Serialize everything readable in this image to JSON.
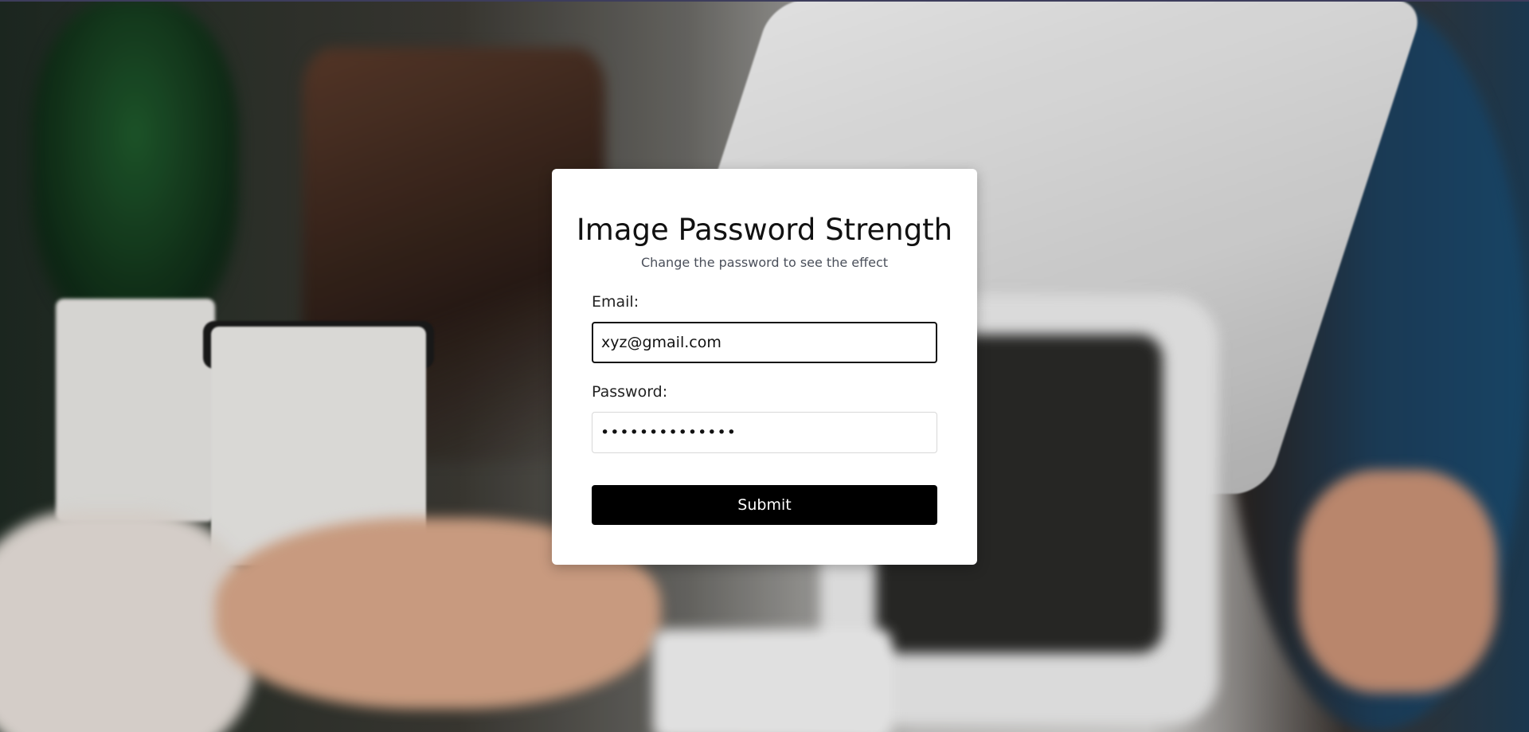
{
  "card": {
    "title": "Image Password Strength",
    "subtitle": "Change the password to see the effect"
  },
  "form": {
    "email_label": "Email:",
    "email_value": "xyz@gmail.com",
    "password_label": "Password:",
    "password_value": "••••••••••••••",
    "submit_label": "Submit"
  },
  "colors": {
    "button_bg": "#000000",
    "card_bg": "#ffffff"
  }
}
